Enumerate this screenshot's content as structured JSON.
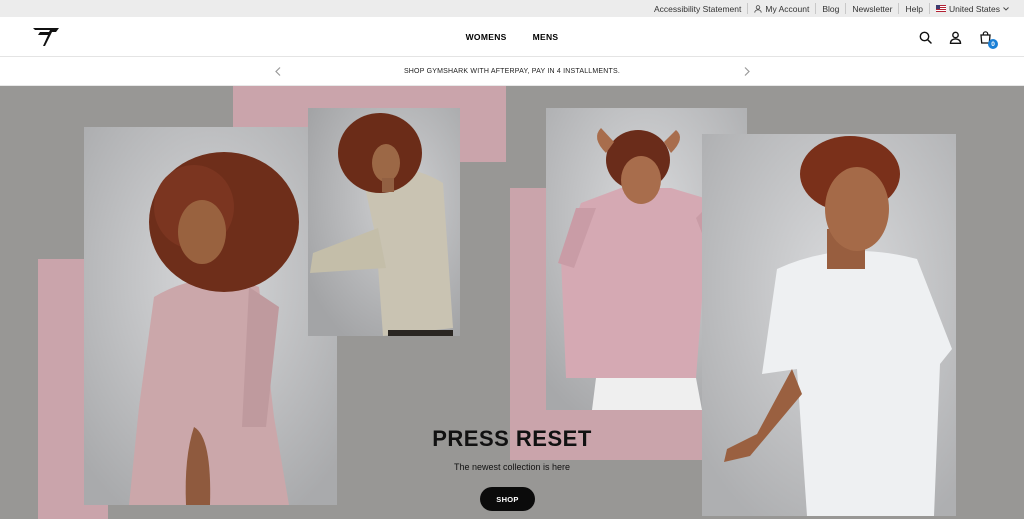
{
  "utility_bar": {
    "accessibility": "Accessibility Statement",
    "my_account": "My Account",
    "blog": "Blog",
    "newsletter": "Newsletter",
    "help": "Help",
    "country": "United States"
  },
  "header": {
    "logo_icon": "gymshark-logo-icon",
    "nav": [
      "WOMENS",
      "MENS"
    ],
    "icons": [
      "search-icon",
      "account-icon",
      "bag-icon"
    ],
    "cart_count": "0"
  },
  "promo": {
    "text": "SHOP GYMSHARK WITH AFTERPAY, PAY IN 4 INSTALLMENTS.",
    "prev_icon": "chevron-left-icon",
    "next_icon": "chevron-right-icon"
  },
  "hero": {
    "title": "PRESS RESET",
    "subtitle": "The newest collection is here",
    "cta": "SHOP",
    "colors": {
      "background": "#989795",
      "accent_pink": "#caa4ab",
      "button": "#0b0b0b"
    }
  }
}
